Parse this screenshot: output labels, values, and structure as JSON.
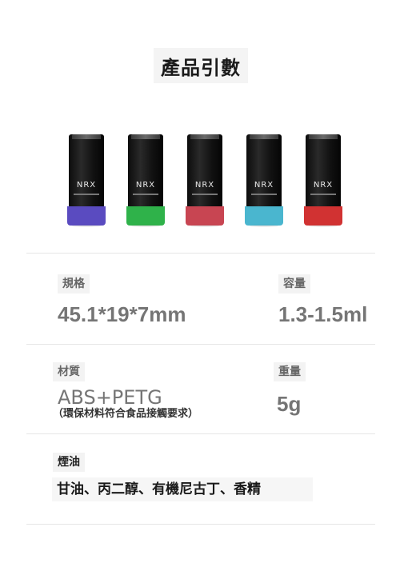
{
  "title": "產品引數",
  "products": [
    {
      "brand": "NRX",
      "base_color": "#5a4bc0"
    },
    {
      "brand": "NRX",
      "base_color": "#2fb24a"
    },
    {
      "brand": "NRX",
      "base_color": "#c84552"
    },
    {
      "brand": "NRX",
      "base_color": "#4ab6cf"
    },
    {
      "brand": "NRX",
      "base_color": "#d13232"
    }
  ],
  "specs": {
    "size_label": "規格",
    "size_value": "45.1*19*7mm",
    "capacity_label": "容量",
    "capacity_value": "1.3-1.5ml",
    "material_label": "材質",
    "material_value": "ABS+PETG",
    "material_note": "（環保材料符合食品接觸要求）",
    "weight_label": "重量",
    "weight_value": "5g",
    "oil_label": "煙油",
    "oil_value": "甘油、丙二醇、有機尼古丁、香精"
  }
}
